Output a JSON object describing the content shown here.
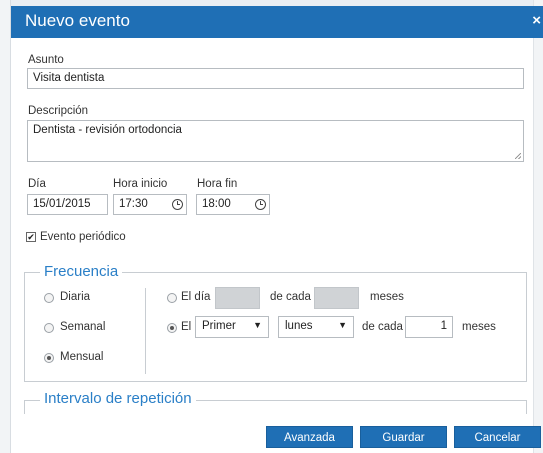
{
  "dialog": {
    "title": "Nuevo evento",
    "close_symbol": "×"
  },
  "form": {
    "asunto_label": "Asunto",
    "asunto_value": "Visita dentista",
    "descripcion_label": "Descripción",
    "descripcion_value": "Dentista - revisión ortodoncia",
    "dia_label": "Día",
    "dia_value": "15/01/2015",
    "hora_inicio_label": "Hora inicio",
    "hora_inicio_value": "17:30",
    "hora_fin_label": "Hora fin",
    "hora_fin_value": "18:00",
    "periodico_label": "Evento periódico",
    "periodico_checked": true,
    "checkbox_mark": "✔"
  },
  "frecuencia": {
    "legend": "Frecuencia",
    "options": [
      "Diaria",
      "Semanal",
      "Mensual"
    ],
    "selected": "Mensual",
    "row1": {
      "prefix": "El día",
      "middle": "de cada",
      "suffix": "meses"
    },
    "row2": {
      "prefix": "El",
      "ordinal_value": "Primer",
      "weekday_value": "lunes",
      "middle": "de cada",
      "months_value": "1",
      "suffix": "meses",
      "selected": true
    },
    "select_arrow": "▼"
  },
  "repeticion": {
    "legend": "Intervalo de repetición"
  },
  "buttons": {
    "advanced": "Avanzada",
    "save": "Guardar",
    "cancel": "Cancelar"
  },
  "colors": {
    "primary": "#1f6fb5",
    "legend": "#2a7fc7"
  }
}
